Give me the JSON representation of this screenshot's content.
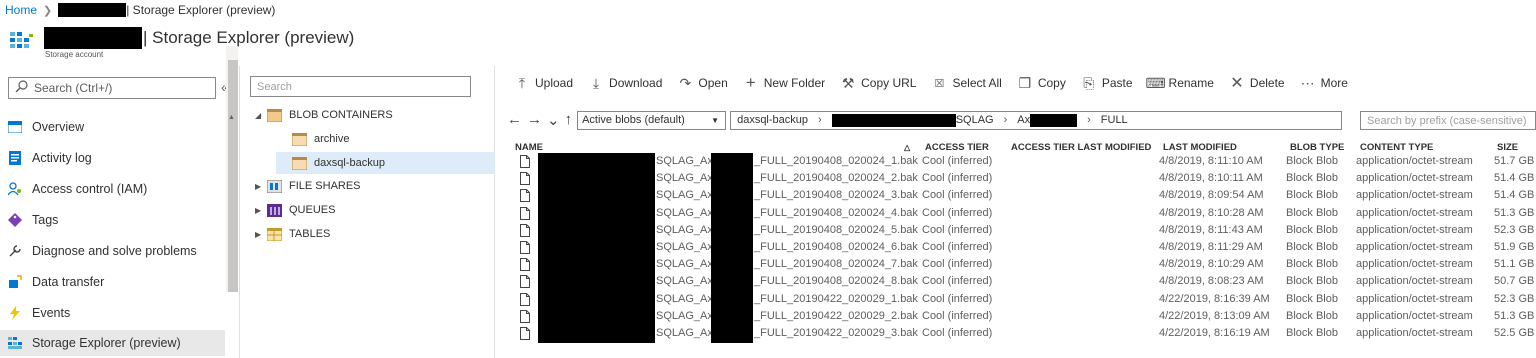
{
  "breadcrumb": {
    "home": "Home",
    "current": "| Storage Explorer (preview)"
  },
  "header": {
    "title": "| Storage Explorer (preview)",
    "subtitle": "Storage account"
  },
  "leftnav": {
    "search_placeholder": "Search (Ctrl+/)",
    "collapse": "«",
    "items": [
      {
        "label": "Overview",
        "icon": "overview-icon"
      },
      {
        "label": "Activity log",
        "icon": "activity-log-icon"
      },
      {
        "label": "Access control (IAM)",
        "icon": "access-control-icon"
      },
      {
        "label": "Tags",
        "icon": "tag-icon"
      },
      {
        "label": "Diagnose and solve problems",
        "icon": "wrench-icon"
      },
      {
        "label": "Data transfer",
        "icon": "data-transfer-icon"
      },
      {
        "label": "Events",
        "icon": "lightning-icon"
      },
      {
        "label": "Storage Explorer (preview)",
        "icon": "storage-explorer-icon",
        "selected": true
      }
    ]
  },
  "tree": {
    "search_placeholder": "Search",
    "blob_containers": "BLOB CONTAINERS",
    "archive": "archive",
    "daxsql_backup": "daxsql-backup",
    "file_shares": "FILE SHARES",
    "queues": "QUEUES",
    "tables": "TABLES"
  },
  "toolbar": {
    "upload": "Upload",
    "download": "Download",
    "open": "Open",
    "new_folder": "New Folder",
    "copy_url": "Copy URL",
    "select_all": "Select All",
    "copy": "Copy",
    "paste": "Paste",
    "rename": "Rename",
    "delete": "Delete",
    "more": "More"
  },
  "pathbar": {
    "blob_filter": "Active blobs (default)",
    "path_root": "daxsql-backup",
    "path_segment_2": "SQLAG",
    "path_segment_3": "Ax",
    "path_segment_4": "FULL",
    "prefix_placeholder": "Search by prefix (case-sensitive)"
  },
  "columns": {
    "name": "NAME",
    "access_tier": "ACCESS TIER",
    "access_tier_last_modified": "ACCESS TIER LAST MODIFIED",
    "last_modified": "LAST MODIFIED",
    "blob_type": "BLOB TYPE",
    "content_type": "CONTENT TYPE",
    "size": "SIZE"
  },
  "rows": [
    {
      "n1": "SQLAG_Ax",
      "n2": "_FULL_20190408_020024_1.bak",
      "tier": "Cool (inferred)",
      "modified": "4/8/2019, 8:11:10 AM",
      "type": "Block Blob",
      "ctype": "application/octet-stream",
      "size": "51.7 GB"
    },
    {
      "n1": "SQLAG_Ax",
      "n2": "_FULL_20190408_020024_2.bak",
      "tier": "Cool (inferred)",
      "modified": "4/8/2019, 8:10:11 AM",
      "type": "Block Blob",
      "ctype": "application/octet-stream",
      "size": "51.4 GB"
    },
    {
      "n1": "SQLAG_Ax",
      "n2": "_FULL_20190408_020024_3.bak",
      "tier": "Cool (inferred)",
      "modified": "4/8/2019, 8:09:54 AM",
      "type": "Block Blob",
      "ctype": "application/octet-stream",
      "size": "51.4 GB"
    },
    {
      "n1": "SQLAG_Ax",
      "n2": "_FULL_20190408_020024_4.bak",
      "tier": "Cool (inferred)",
      "modified": "4/8/2019, 8:10:28 AM",
      "type": "Block Blob",
      "ctype": "application/octet-stream",
      "size": "51.3 GB"
    },
    {
      "n1": "SQLAG_Ax",
      "n2": "_FULL_20190408_020024_5.bak",
      "tier": "Cool (inferred)",
      "modified": "4/8/2019, 8:11:43 AM",
      "type": "Block Blob",
      "ctype": "application/octet-stream",
      "size": "52.3 GB"
    },
    {
      "n1": "SQLAG_Ax",
      "n2": "_FULL_20190408_020024_6.bak",
      "tier": "Cool (inferred)",
      "modified": "4/8/2019, 8:11:29 AM",
      "type": "Block Blob",
      "ctype": "application/octet-stream",
      "size": "51.9 GB"
    },
    {
      "n1": "SQLAG_Ax",
      "n2": "_FULL_20190408_020024_7.bak",
      "tier": "Cool (inferred)",
      "modified": "4/8/2019, 8:10:29 AM",
      "type": "Block Blob",
      "ctype": "application/octet-stream",
      "size": "51.1 GB"
    },
    {
      "n1": "SQLAG_Ax",
      "n2": "_FULL_20190408_020024_8.bak",
      "tier": "Cool (inferred)",
      "modified": "4/8/2019, 8:08:23 AM",
      "type": "Block Blob",
      "ctype": "application/octet-stream",
      "size": "50.7 GB"
    },
    {
      "n1": "SQLAG_Ax",
      "n2": "_FULL_20190422_020029_1.bak",
      "tier": "Cool (inferred)",
      "modified": "4/22/2019, 8:16:39 AM",
      "type": "Block Blob",
      "ctype": "application/octet-stream",
      "size": "52.3 GB"
    },
    {
      "n1": "SQLAG_Ax",
      "n2": "_FULL_20190422_020029_2.bak",
      "tier": "Cool (inferred)",
      "modified": "4/22/2019, 8:13:09 AM",
      "type": "Block Blob",
      "ctype": "application/octet-stream",
      "size": "51.3 GB"
    },
    {
      "n1": "SQLAG_Ax",
      "n2": "_FULL_20190422_020029_3.bak",
      "tier": "Cool (inferred)",
      "modified": "4/22/2019, 8:16:19 AM",
      "type": "Block Blob",
      "ctype": "application/octet-stream",
      "size": "52.5 GB"
    }
  ],
  "colors": {
    "accent": "#0078d4",
    "selected_tree_bg": "#deecf9",
    "selected_nav_bg": "#e8e8e8"
  }
}
